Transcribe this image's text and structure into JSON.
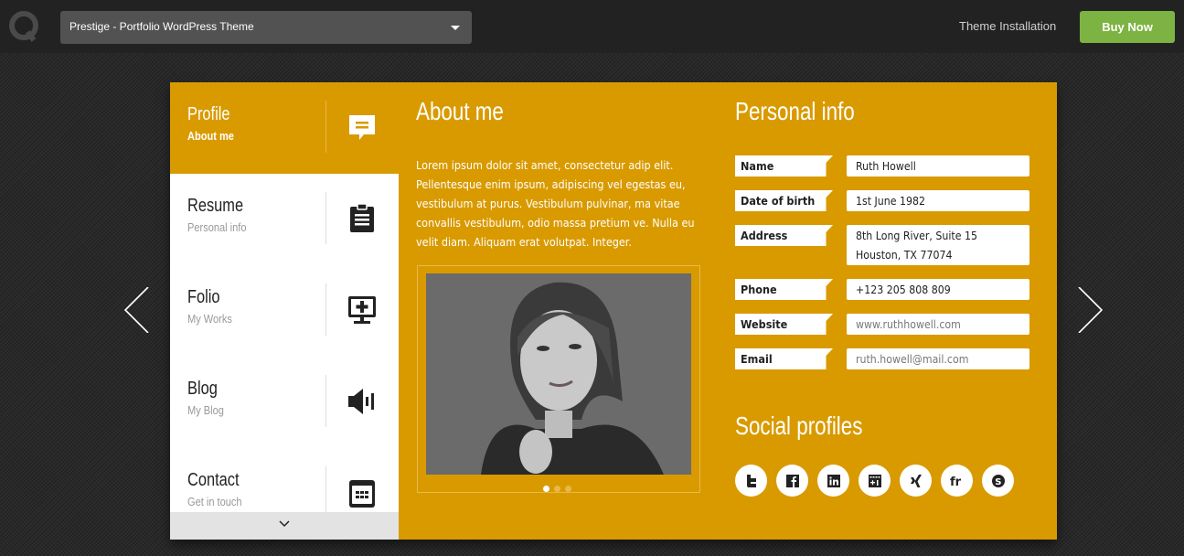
{
  "topbar": {
    "theme_selector": "Prestige - Portfolio WordPress Theme",
    "nav_link": "Theme Installation",
    "buy_button": "Buy Now"
  },
  "colors": {
    "accent": "#d99a00",
    "buy_green": "#7cb342",
    "topbar": "#222222"
  },
  "sidebar": {
    "items": [
      {
        "title": "Profile",
        "subtitle": "About me",
        "icon": "speech-bubble-icon",
        "active": true
      },
      {
        "title": "Resume",
        "subtitle": "Personal info",
        "icon": "clipboard-icon",
        "active": false
      },
      {
        "title": "Folio",
        "subtitle": "My Works",
        "icon": "monitor-plus-icon",
        "active": false
      },
      {
        "title": "Blog",
        "subtitle": "My Blog",
        "icon": "megaphone-icon",
        "active": false
      },
      {
        "title": "Contact",
        "subtitle": "Get in touch",
        "icon": "calendar-icon",
        "active": false
      }
    ]
  },
  "about": {
    "title": "About me",
    "text": "Lorem ipsum dolor sit amet, consectetur adip elit. Pellentesque enim ipsum, adipiscing vel egestas eu, vestibulum at purus. Vestibulum pulvinar, ma vitae convallis vestibulum, odio massa pretium ve. Nulla eu velit diam. Aliquam erat volutpat. Integer.",
    "slider": {
      "total_slides": 3,
      "current_slide": 1
    }
  },
  "personal_info": {
    "title": "Personal info",
    "fields": [
      {
        "label": "Name",
        "value": "Ruth Howell"
      },
      {
        "label": "Date of birth",
        "value": "1st June 1982"
      },
      {
        "label": "Address",
        "value": "8th Long River, Suite 15",
        "value2": "Houston, TX 77074"
      },
      {
        "label": "Phone",
        "value": "+123 205 808 809"
      },
      {
        "label": "Website",
        "value": "www.ruthhowell.com"
      },
      {
        "label": "Email",
        "value": "ruth.howell@mail.com"
      }
    ]
  },
  "social": {
    "title": "Social profiles",
    "profiles": [
      "twitter-icon",
      "facebook-icon",
      "linkedin-icon",
      "google-plus-icon",
      "xing-icon",
      "friendfeed-icon",
      "skype-icon"
    ]
  }
}
